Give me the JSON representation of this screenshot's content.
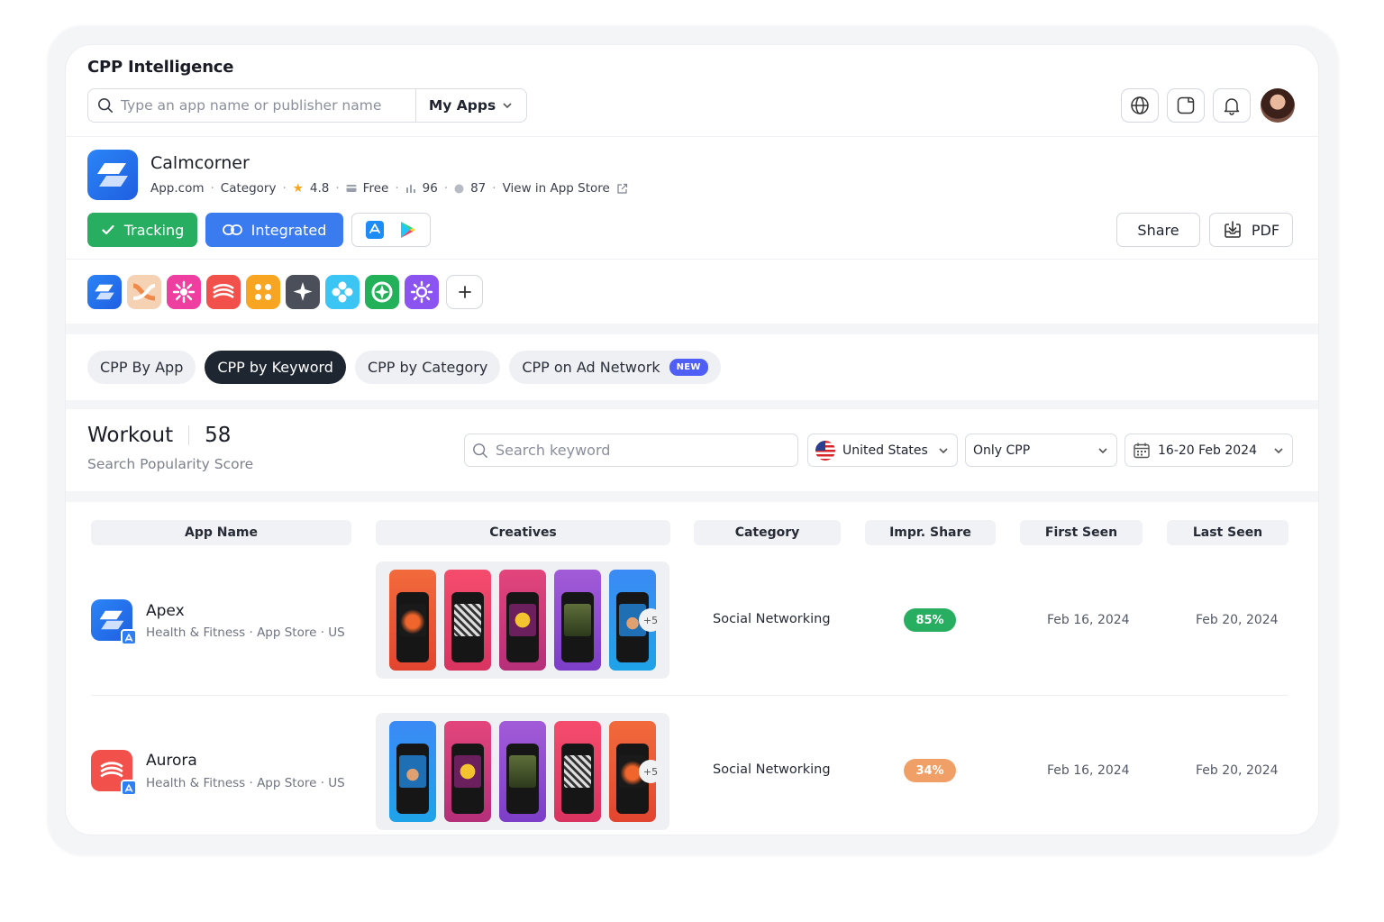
{
  "header": {
    "title": "CPP Intelligence",
    "search_placeholder": "Type an app name or publisher name",
    "my_apps": "My Apps"
  },
  "app": {
    "name": "Calmcorner",
    "publisher": "App.com",
    "category": "Category",
    "rating": "4.8",
    "price": "Free",
    "stat1": "96",
    "stat2": "87",
    "view_link": "View in App Store"
  },
  "actions": {
    "tracking": "Tracking",
    "integrated": "Integrated",
    "share": "Share",
    "pdf": "PDF"
  },
  "tabs": [
    {
      "label": "CPP By App"
    },
    {
      "label": "CPP by Keyword"
    },
    {
      "label": "CPP by Category"
    },
    {
      "label": "CPP on Ad Network",
      "badge": "NEW"
    }
  ],
  "keyword": {
    "word": "Workout",
    "score": "58",
    "subtitle": "Search Popularity Score",
    "search_placeholder": "Search keyword"
  },
  "filters": {
    "country": "United States",
    "cpp": "Only CPP",
    "date_range": "16-20 Feb 2024"
  },
  "table": {
    "headers": [
      "App Name",
      "Creatives",
      "Category",
      "Impr. Share",
      "First Seen",
      "Last Seen"
    ],
    "rows": [
      {
        "name": "Apex",
        "sub": "Health & Fitness · App Store · US",
        "more": "+5",
        "category": "Social Networking",
        "share": "85%",
        "share_color": "#27ae60",
        "first_seen": "Feb 16, 2024",
        "last_seen": "Feb 20, 2024"
      },
      {
        "name": "Aurora",
        "sub": "Health & Fitness · App Store · US",
        "more": "+5",
        "category": "Social Networking",
        "share": "34%",
        "share_color": "#f0a067",
        "first_seen": "Feb 16, 2024",
        "last_seen": "Feb 20, 2024"
      }
    ]
  },
  "colors": {
    "accent_blue": "#3b7bf0",
    "tracking_green": "#27ae60",
    "active_tab": "#1e2632"
  }
}
